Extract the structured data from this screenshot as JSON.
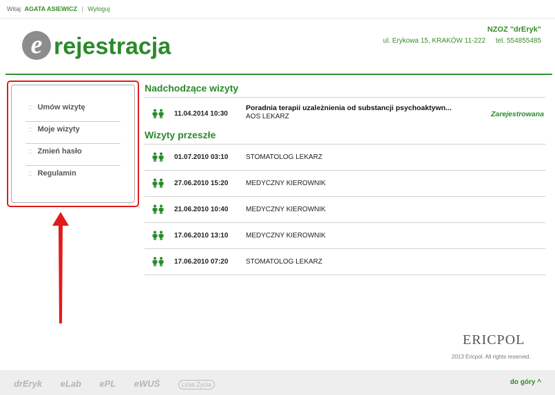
{
  "topbar": {
    "greeting": "Witaj",
    "user_name": "AGATA ASIEWICZ",
    "separator": "|",
    "logout": "Wyloguj"
  },
  "header": {
    "logo_letter": "e",
    "logo_text": "rejestracja",
    "clinic_name": "NZOZ \"drEryk\"",
    "clinic_address": "ul. Erykowa 15, KRAKÓW 11-222",
    "clinic_phone": "tel. 554855485"
  },
  "sidebar": {
    "items": [
      {
        "bullet": "::",
        "label": "Umów wizytę"
      },
      {
        "bullet": "::",
        "label": "Moje wizyty"
      },
      {
        "bullet": "::",
        "label": "Zmień hasło"
      },
      {
        "bullet": "::",
        "label": "Regulamin"
      }
    ]
  },
  "main": {
    "upcoming_title": "Nadchodzące wizyty",
    "upcoming": [
      {
        "date": "11.04.2014 10:30",
        "title": "Poradnia terapii uzależnienia od substancji psychoaktywn...",
        "subtitle": "AOS LEKARZ",
        "status": "Zarejestrowana"
      }
    ],
    "past_title": "Wizyty przeszłe",
    "past": [
      {
        "date": "01.07.2010 03:10",
        "desc": "STOMATOLOG LEKARZ"
      },
      {
        "date": "27.06.2010 15:20",
        "desc": "MEDYCZNY KIEROWNIK"
      },
      {
        "date": "21.06.2010 10:40",
        "desc": "MEDYCZNY KIEROWNIK"
      },
      {
        "date": "17.06.2010 13:10",
        "desc": "MEDYCZNY KIEROWNIK"
      },
      {
        "date": "17.06.2010 07:20",
        "desc": "STOMATOLOG LEKARZ"
      }
    ]
  },
  "footer": {
    "ericpol_logo": "ERICPOL",
    "copyright": "2013 Ericpol. All rights reserved.",
    "brands": [
      "drEryk",
      "eLab",
      "ePL",
      "eWUŚ",
      "Linia Życia"
    ],
    "to_top": "do góry ^"
  },
  "colors": {
    "brand_green": "#2a8a2a",
    "annotation_red": "#e21a1a"
  }
}
